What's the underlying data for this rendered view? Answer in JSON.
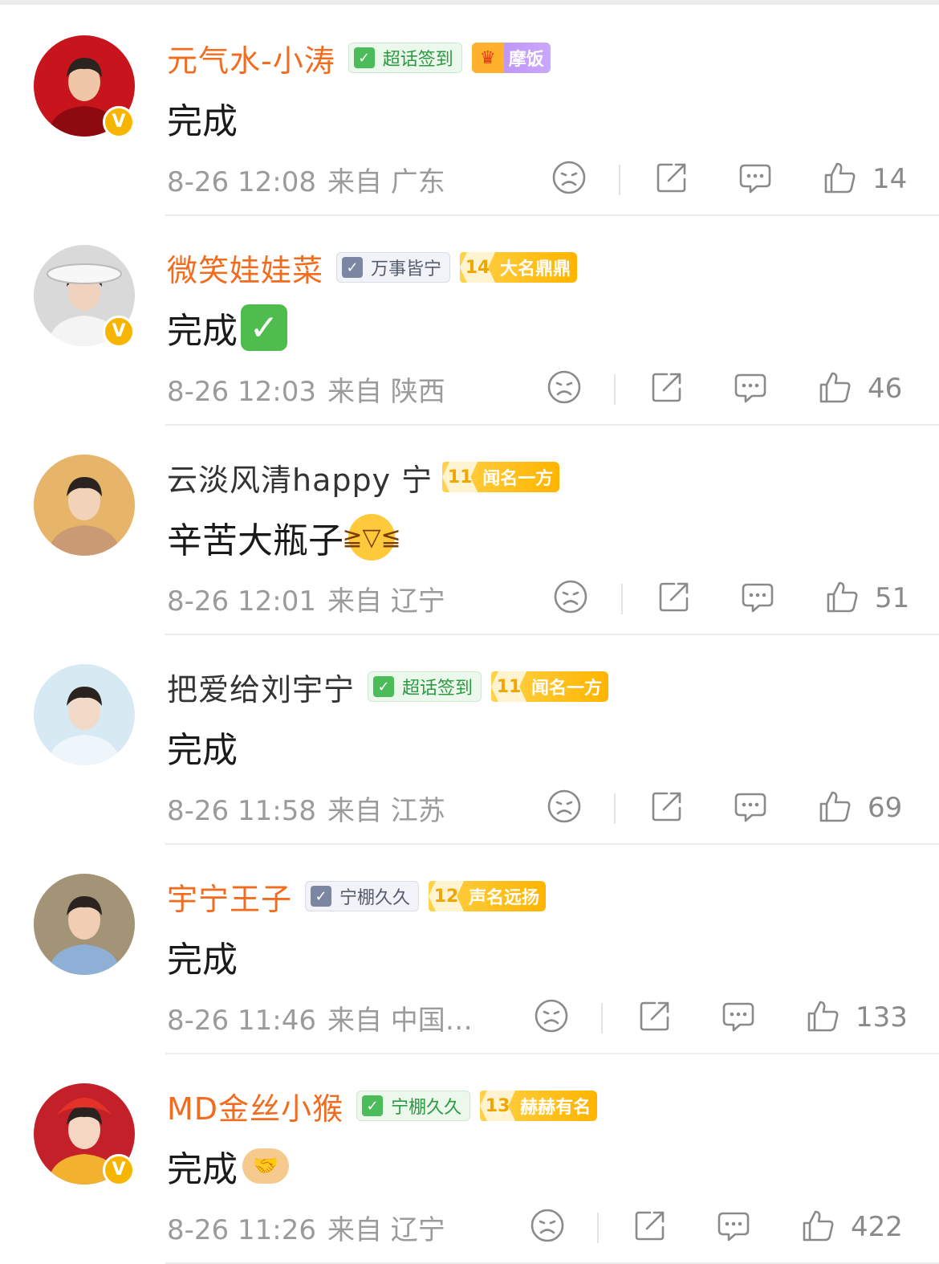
{
  "comments": [
    {
      "username": "元气水-小涛",
      "name_color": "orange",
      "verified": true,
      "badges": [
        {
          "kind": "checkin",
          "label": "超话签到",
          "style": "green"
        },
        {
          "kind": "crown",
          "label": "摩饭",
          "icon": "crown-icon"
        }
      ],
      "content": "完成",
      "emoji": null,
      "date": "8-26 12:08",
      "location": "来自 广东",
      "likes": "14",
      "avatar": {
        "bg": "#c8141c",
        "fg": "#8c0a10",
        "skin": "#f0c6a8"
      }
    },
    {
      "username": "微笑娃娃菜",
      "name_color": "orange",
      "verified": true,
      "badges": [
        {
          "kind": "checkin",
          "label": "万事皆宁",
          "style": "gray"
        },
        {
          "kind": "level",
          "level": "14",
          "label": "大名鼎鼎"
        }
      ],
      "content": "完成",
      "emoji": "check-mark-emoji",
      "date": "8-26 12:03",
      "location": "来自 陕西",
      "likes": "46",
      "avatar": {
        "bg": "#d9d9d9",
        "fg": "#f4f4f4",
        "skin": "#f1d2bf"
      }
    },
    {
      "username": "云淡风清happy 宁",
      "name_color": "gray",
      "verified": false,
      "badges": [
        {
          "kind": "level",
          "level": "11",
          "label": "闻名一方"
        }
      ],
      "content": "辛苦大瓶子",
      "emoji": "laughing-face-emoji",
      "date": "8-26 12:01",
      "location": "来自 辽宁",
      "likes": "51",
      "avatar": {
        "bg": "#e6b56a",
        "fg": "#c99a74",
        "skin": "#f2d2b8"
      }
    },
    {
      "username": "把爱给刘宇宁",
      "name_color": "gray",
      "verified": false,
      "badges": [
        {
          "kind": "checkin",
          "label": "超话签到",
          "style": "green"
        },
        {
          "kind": "level",
          "level": "11",
          "label": "闻名一方"
        }
      ],
      "content": "完成",
      "emoji": null,
      "date": "8-26 11:58",
      "location": "来自 江苏",
      "likes": "69",
      "avatar": {
        "bg": "#d7e9f3",
        "fg": "#eef6fb",
        "skin": "#f3d9c7"
      }
    },
    {
      "username": "宇宁王子",
      "name_color": "orange",
      "verified": false,
      "badges": [
        {
          "kind": "checkin",
          "label": "宁棚久久",
          "style": "gray"
        },
        {
          "kind": "level",
          "level": "12",
          "label": "声名远扬"
        }
      ],
      "content": "完成",
      "emoji": null,
      "date": "8-26 11:46",
      "location": "来自 中国…",
      "likes": "133",
      "avatar": {
        "bg": "#a39377",
        "fg": "#8fb0d6",
        "skin": "#f0cdb3"
      }
    },
    {
      "username": "MD金丝小猴",
      "name_color": "orange",
      "verified": true,
      "badges": [
        {
          "kind": "checkin",
          "label": "宁棚久久",
          "style": "green"
        },
        {
          "kind": "level",
          "level": "13",
          "label": "赫赫有名"
        }
      ],
      "content": "完成",
      "emoji": "handshake-emoji",
      "date": "8-26 11:26",
      "location": "来自 辽宁",
      "likes": "422",
      "avatar": {
        "bg": "#c4202a",
        "fg": "#f2b230",
        "skin": "#f4d6c2"
      }
    }
  ],
  "icons": {
    "dislike": "sad-face-icon",
    "share": "share-icon",
    "reply": "comment-bubble-icon",
    "like": "thumbs-up-icon",
    "verified": "verified-v-icon"
  },
  "colors": {
    "username_orange": "#f26c1f",
    "verified_badge": "#f7b500",
    "level_badge": "#ffb400",
    "meta_text": "#9b9b9b"
  }
}
